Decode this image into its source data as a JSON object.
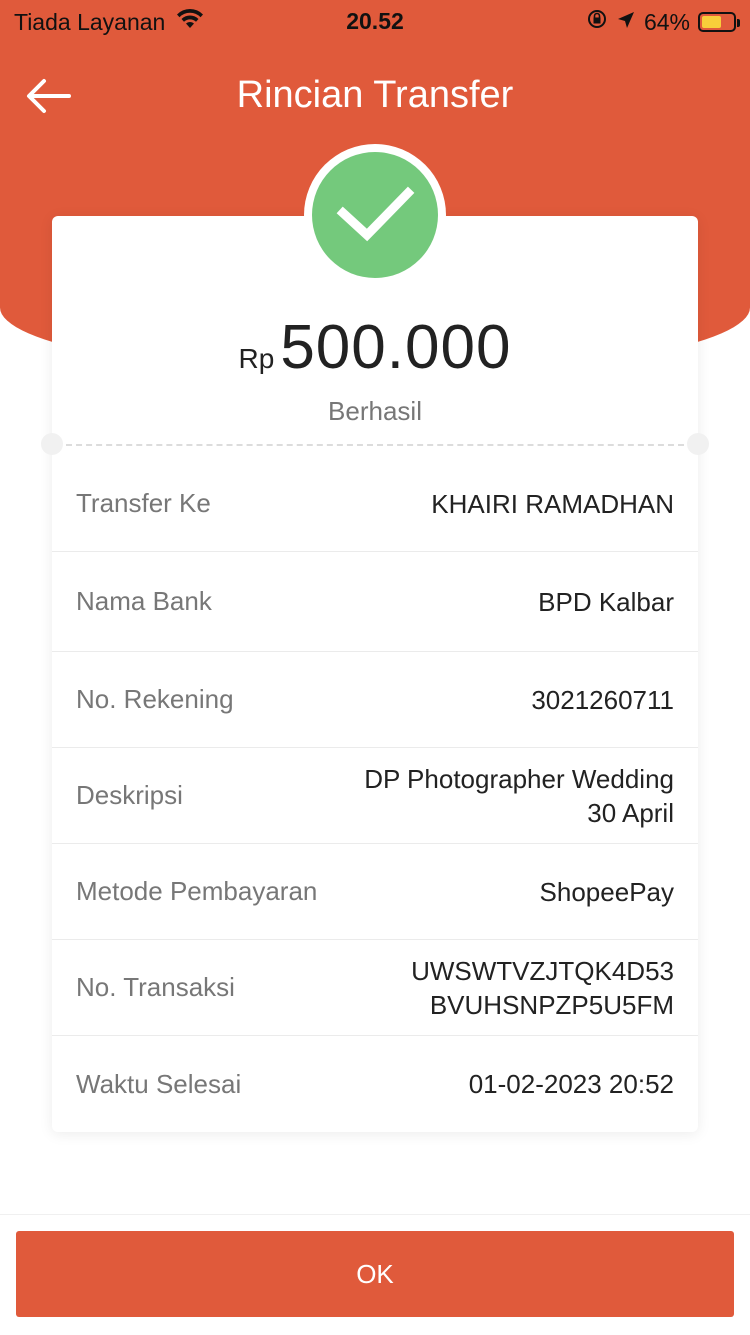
{
  "status_bar": {
    "carrier": "Tiada Layanan",
    "time": "20.52",
    "battery": "64%",
    "battery_level": 0.64
  },
  "header": {
    "title": "Rincian Transfer",
    "bg_color": "#E05A3B"
  },
  "summary": {
    "currency": "Rp",
    "amount": "500.000",
    "status": "Berhasil",
    "status_color": "#74C97C"
  },
  "details": [
    {
      "label": "Transfer Ke",
      "value": "KHAIRI RAMADHAN"
    },
    {
      "label": "Nama Bank",
      "value": "BPD Kalbar"
    },
    {
      "label": "No. Rekening",
      "value": "3021260711"
    },
    {
      "label": "Deskripsi",
      "value_line1": "DP Photographer Wedding",
      "value_line2": "30 April"
    },
    {
      "label": "Metode Pembayaran",
      "value": "ShopeePay"
    },
    {
      "label": "No. Transaksi",
      "value_line1": "UWSWTVZJTQK4D53",
      "value_line2": "BVUHSNPZP5U5FM"
    },
    {
      "label": "Waktu Selesai",
      "value": "01-02-2023 20:52"
    }
  ],
  "footer": {
    "ok_label": "OK"
  }
}
